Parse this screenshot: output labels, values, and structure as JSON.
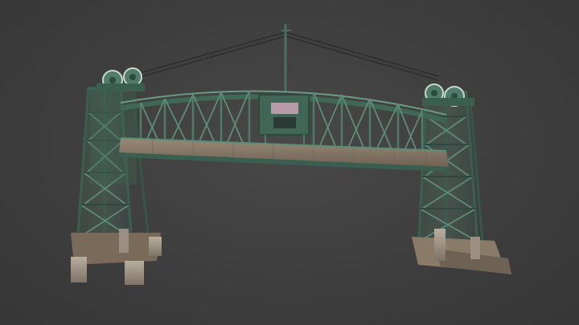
{
  "viewer": {
    "background_color": "#3d3d3d"
  },
  "model": {
    "subject": "bridge-3d-model",
    "colors": {
      "steel_green": "#4f7b6a",
      "steel_dark": "#2e4a40",
      "steel_light": "#8fb3a2",
      "deck_wood": "#8a7a68",
      "deck_dark": "#5e5246",
      "concrete": "#a49a8c",
      "rust": "#7a5a44"
    }
  }
}
